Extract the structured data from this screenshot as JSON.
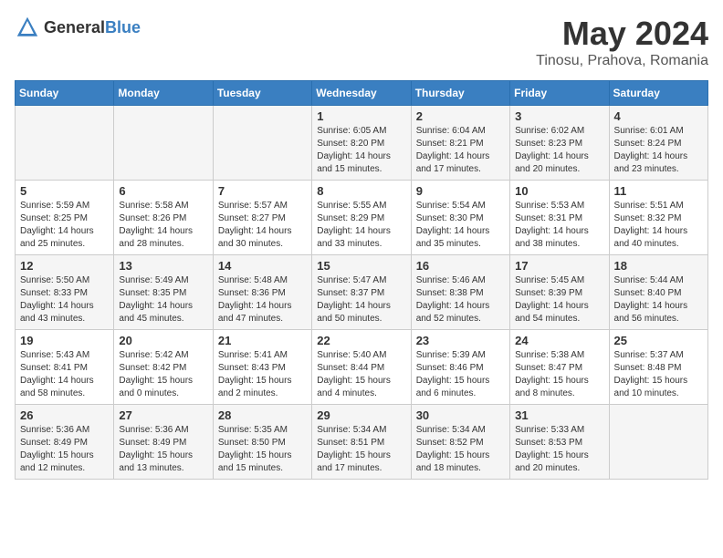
{
  "header": {
    "logo_general": "General",
    "logo_blue": "Blue",
    "month_title": "May 2024",
    "location": "Tinosu, Prahova, Romania"
  },
  "days_of_week": [
    "Sunday",
    "Monday",
    "Tuesday",
    "Wednesday",
    "Thursday",
    "Friday",
    "Saturday"
  ],
  "weeks": [
    [
      {
        "day": "",
        "info": ""
      },
      {
        "day": "",
        "info": ""
      },
      {
        "day": "",
        "info": ""
      },
      {
        "day": "1",
        "info": "Sunrise: 6:05 AM\nSunset: 8:20 PM\nDaylight: 14 hours\nand 15 minutes."
      },
      {
        "day": "2",
        "info": "Sunrise: 6:04 AM\nSunset: 8:21 PM\nDaylight: 14 hours\nand 17 minutes."
      },
      {
        "day": "3",
        "info": "Sunrise: 6:02 AM\nSunset: 8:23 PM\nDaylight: 14 hours\nand 20 minutes."
      },
      {
        "day": "4",
        "info": "Sunrise: 6:01 AM\nSunset: 8:24 PM\nDaylight: 14 hours\nand 23 minutes."
      }
    ],
    [
      {
        "day": "5",
        "info": "Sunrise: 5:59 AM\nSunset: 8:25 PM\nDaylight: 14 hours\nand 25 minutes."
      },
      {
        "day": "6",
        "info": "Sunrise: 5:58 AM\nSunset: 8:26 PM\nDaylight: 14 hours\nand 28 minutes."
      },
      {
        "day": "7",
        "info": "Sunrise: 5:57 AM\nSunset: 8:27 PM\nDaylight: 14 hours\nand 30 minutes."
      },
      {
        "day": "8",
        "info": "Sunrise: 5:55 AM\nSunset: 8:29 PM\nDaylight: 14 hours\nand 33 minutes."
      },
      {
        "day": "9",
        "info": "Sunrise: 5:54 AM\nSunset: 8:30 PM\nDaylight: 14 hours\nand 35 minutes."
      },
      {
        "day": "10",
        "info": "Sunrise: 5:53 AM\nSunset: 8:31 PM\nDaylight: 14 hours\nand 38 minutes."
      },
      {
        "day": "11",
        "info": "Sunrise: 5:51 AM\nSunset: 8:32 PM\nDaylight: 14 hours\nand 40 minutes."
      }
    ],
    [
      {
        "day": "12",
        "info": "Sunrise: 5:50 AM\nSunset: 8:33 PM\nDaylight: 14 hours\nand 43 minutes."
      },
      {
        "day": "13",
        "info": "Sunrise: 5:49 AM\nSunset: 8:35 PM\nDaylight: 14 hours\nand 45 minutes."
      },
      {
        "day": "14",
        "info": "Sunrise: 5:48 AM\nSunset: 8:36 PM\nDaylight: 14 hours\nand 47 minutes."
      },
      {
        "day": "15",
        "info": "Sunrise: 5:47 AM\nSunset: 8:37 PM\nDaylight: 14 hours\nand 50 minutes."
      },
      {
        "day": "16",
        "info": "Sunrise: 5:46 AM\nSunset: 8:38 PM\nDaylight: 14 hours\nand 52 minutes."
      },
      {
        "day": "17",
        "info": "Sunrise: 5:45 AM\nSunset: 8:39 PM\nDaylight: 14 hours\nand 54 minutes."
      },
      {
        "day": "18",
        "info": "Sunrise: 5:44 AM\nSunset: 8:40 PM\nDaylight: 14 hours\nand 56 minutes."
      }
    ],
    [
      {
        "day": "19",
        "info": "Sunrise: 5:43 AM\nSunset: 8:41 PM\nDaylight: 14 hours\nand 58 minutes."
      },
      {
        "day": "20",
        "info": "Sunrise: 5:42 AM\nSunset: 8:42 PM\nDaylight: 15 hours\nand 0 minutes."
      },
      {
        "day": "21",
        "info": "Sunrise: 5:41 AM\nSunset: 8:43 PM\nDaylight: 15 hours\nand 2 minutes."
      },
      {
        "day": "22",
        "info": "Sunrise: 5:40 AM\nSunset: 8:44 PM\nDaylight: 15 hours\nand 4 minutes."
      },
      {
        "day": "23",
        "info": "Sunrise: 5:39 AM\nSunset: 8:46 PM\nDaylight: 15 hours\nand 6 minutes."
      },
      {
        "day": "24",
        "info": "Sunrise: 5:38 AM\nSunset: 8:47 PM\nDaylight: 15 hours\nand 8 minutes."
      },
      {
        "day": "25",
        "info": "Sunrise: 5:37 AM\nSunset: 8:48 PM\nDaylight: 15 hours\nand 10 minutes."
      }
    ],
    [
      {
        "day": "26",
        "info": "Sunrise: 5:36 AM\nSunset: 8:49 PM\nDaylight: 15 hours\nand 12 minutes."
      },
      {
        "day": "27",
        "info": "Sunrise: 5:36 AM\nSunset: 8:49 PM\nDaylight: 15 hours\nand 13 minutes."
      },
      {
        "day": "28",
        "info": "Sunrise: 5:35 AM\nSunset: 8:50 PM\nDaylight: 15 hours\nand 15 minutes."
      },
      {
        "day": "29",
        "info": "Sunrise: 5:34 AM\nSunset: 8:51 PM\nDaylight: 15 hours\nand 17 minutes."
      },
      {
        "day": "30",
        "info": "Sunrise: 5:34 AM\nSunset: 8:52 PM\nDaylight: 15 hours\nand 18 minutes."
      },
      {
        "day": "31",
        "info": "Sunrise: 5:33 AM\nSunset: 8:53 PM\nDaylight: 15 hours\nand 20 minutes."
      },
      {
        "day": "",
        "info": ""
      }
    ]
  ]
}
